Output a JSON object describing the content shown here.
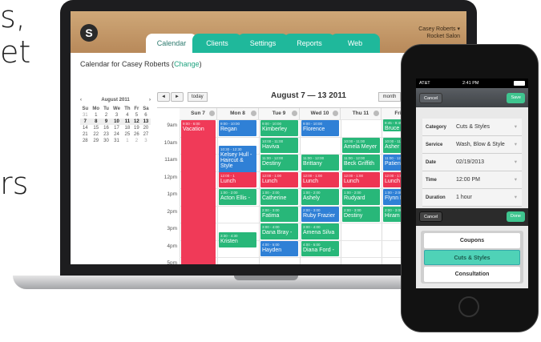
{
  "background_text": [
    "s,",
    "et",
    "rs"
  ],
  "app": {
    "logo": "S",
    "tabs": [
      "Calendar",
      "Clients",
      "Settings",
      "Reports",
      "Web"
    ],
    "user_name": "Casey Roberts",
    "user_salon": "Rocket Salon",
    "page_title": "Calendar for Casey Roberts (",
    "page_title_link": "Change",
    "page_title_end": ")"
  },
  "mini_calendar": {
    "month": "August 2011",
    "prev": "‹",
    "next": "›",
    "weekdays": [
      "Su",
      "Mo",
      "Tu",
      "We",
      "Th",
      "Fr",
      "Sa"
    ],
    "weeks": [
      [
        "31",
        "1",
        "2",
        "3",
        "4",
        "5",
        "6"
      ],
      [
        "7",
        "8",
        "9",
        "10",
        "11",
        "12",
        "13"
      ],
      [
        "14",
        "15",
        "16",
        "17",
        "18",
        "19",
        "20"
      ],
      [
        "21",
        "22",
        "23",
        "24",
        "25",
        "26",
        "27"
      ],
      [
        "28",
        "29",
        "30",
        "31",
        "1",
        "2",
        "3"
      ]
    ]
  },
  "toolbar": {
    "prev": "◄",
    "next": "►",
    "today": "today",
    "week_title": "August 7 — 13 2011",
    "month": "month"
  },
  "grid": {
    "days": [
      "Sun 7",
      "Mon 8",
      "Tue 9",
      "Wed 10",
      "Thu 11",
      "Fri 12"
    ],
    "hours": [
      "9am",
      "10am",
      "11am",
      "12pm",
      "1pm",
      "2pm",
      "3pm",
      "4pm",
      "5pm"
    ]
  },
  "events": [
    {
      "day": 0,
      "start": 9,
      "end": 18,
      "time": "9:00 - 6:00",
      "name": "Vacation",
      "color": "pink"
    },
    {
      "day": 1,
      "start": 9,
      "end": 10,
      "time": "9:00 - 10:00",
      "name": "Regan",
      "color": "blue"
    },
    {
      "day": 1,
      "start": 10.5,
      "end": 12.5,
      "time": "10:30 - 12:30",
      "name": "Kelsey Hull - Haircut & Style",
      "color": "blue"
    },
    {
      "day": 1,
      "start": 12,
      "end": 13,
      "time": "12:00 - 1",
      "name": "Lunch",
      "color": "red"
    },
    {
      "day": 1,
      "start": 13,
      "end": 14,
      "time": "1:00 - 2:00",
      "name": "Acton Ellis -",
      "color": "green"
    },
    {
      "day": 1,
      "start": 15.5,
      "end": 16.5,
      "time": "3:30 - 4:30",
      "name": "Kristen",
      "color": "green"
    },
    {
      "day": 2,
      "start": 9,
      "end": 10,
      "time": "9:00 - 10:00",
      "name": "Kimberley",
      "color": "green"
    },
    {
      "day": 2,
      "start": 10,
      "end": 11,
      "time": "10:00 - 11:00",
      "name": "Haviva",
      "color": "green"
    },
    {
      "day": 2,
      "start": 11,
      "end": 12,
      "time": "11:00 - 12:00",
      "name": "Destiny",
      "color": "green"
    },
    {
      "day": 2,
      "start": 12,
      "end": 13,
      "time": "12:00 - 1:00",
      "name": "Lunch",
      "color": "red"
    },
    {
      "day": 2,
      "start": 13,
      "end": 14,
      "time": "1:00 - 2:00",
      "name": "Catherine",
      "color": "green"
    },
    {
      "day": 2,
      "start": 14,
      "end": 15,
      "time": "2:00 - 3:00",
      "name": "Fatima",
      "color": "green"
    },
    {
      "day": 2,
      "start": 15,
      "end": 16,
      "time": "3:00 - 4:00",
      "name": "Dana Bray -",
      "color": "green"
    },
    {
      "day": 2,
      "start": 16,
      "end": 17,
      "time": "4:00 - 5:00",
      "name": "Hayden",
      "color": "blue"
    },
    {
      "day": 3,
      "start": 9,
      "end": 10,
      "time": "9:00 - 10:00",
      "name": "Florence",
      "color": "blue"
    },
    {
      "day": 3,
      "start": 11,
      "end": 12,
      "time": "11:00 - 12:00",
      "name": "Brittany",
      "color": "green"
    },
    {
      "day": 3,
      "start": 12,
      "end": 13,
      "time": "12:00 - 1:00",
      "name": "Lunch",
      "color": "red"
    },
    {
      "day": 3,
      "start": 13,
      "end": 14,
      "time": "1:00 - 2:00",
      "name": "Ashely",
      "color": "green"
    },
    {
      "day": 3,
      "start": 14,
      "end": 15,
      "time": "2:00 - 3:00",
      "name": "Ruby Frazier",
      "color": "blue"
    },
    {
      "day": 3,
      "start": 15,
      "end": 16,
      "time": "3:00 - 4:00",
      "name": "Amena Silva",
      "color": "green"
    },
    {
      "day": 3,
      "start": 16,
      "end": 17,
      "time": "4:00 - 5:00",
      "name": "Diana Ford -",
      "color": "green"
    },
    {
      "day": 4,
      "start": 10,
      "end": 11,
      "time": "10:00 - 11:00",
      "name": "Amela Meyer",
      "color": "green"
    },
    {
      "day": 4,
      "start": 11,
      "end": 12,
      "time": "11:00 - 12:00",
      "name": "Beck Griffith",
      "color": "green"
    },
    {
      "day": 4,
      "start": 12,
      "end": 13,
      "time": "12:00 - 1:00",
      "name": "Lunch",
      "color": "red"
    },
    {
      "day": 4,
      "start": 13,
      "end": 14,
      "time": "1:00 - 2:00",
      "name": "Rudyard",
      "color": "green"
    },
    {
      "day": 4,
      "start": 14,
      "end": 15,
      "time": "2:00 - 3:00",
      "name": "Destiny",
      "color": "green"
    },
    {
      "day": 5,
      "start": 8.75,
      "end": 9.75,
      "time": "8:45 - 9:45",
      "name": "Bruce",
      "color": "green"
    },
    {
      "day": 5,
      "start": 10,
      "end": 11,
      "time": "10:00 - 11:00",
      "name": "Asher Cook",
      "color": "green"
    },
    {
      "day": 5,
      "start": 11,
      "end": 12,
      "time": "11:00 - 12:00",
      "name": "Patience",
      "color": "blue"
    },
    {
      "day": 5,
      "start": 12,
      "end": 13,
      "time": "12:00 - 1:00",
      "name": "Lunch",
      "color": "red"
    },
    {
      "day": 5,
      "start": 13,
      "end": 14,
      "time": "1:00 - 2:00",
      "name": "Flynn Mccall",
      "color": "blue"
    },
    {
      "day": 5,
      "start": 14,
      "end": 15,
      "time": "2:00 - 3:00",
      "name": "Hiram",
      "color": "green"
    }
  ],
  "phone": {
    "carrier": "AT&T",
    "time": "2:41 PM",
    "cancel": "Cancel",
    "save": "Save",
    "fields": [
      {
        "label": "Category",
        "value": "Cuts & Styles"
      },
      {
        "label": "Service",
        "value": "Wash, Blow & Style"
      },
      {
        "label": "Date",
        "value": "02/19/2013"
      },
      {
        "label": "Time",
        "value": "12:00 PM"
      },
      {
        "label": "Duration",
        "value": "1 hour"
      }
    ],
    "picker_cancel": "Cancel",
    "picker_done": "Done",
    "options": [
      "Coupons",
      "Cuts & Styles",
      "Consultation"
    ],
    "selected_option": "Cuts & Styles"
  },
  "colors": {
    "accent": "#1fb89b",
    "blue": "#2f80d6",
    "green": "#28b779",
    "red": "#ee3553"
  }
}
